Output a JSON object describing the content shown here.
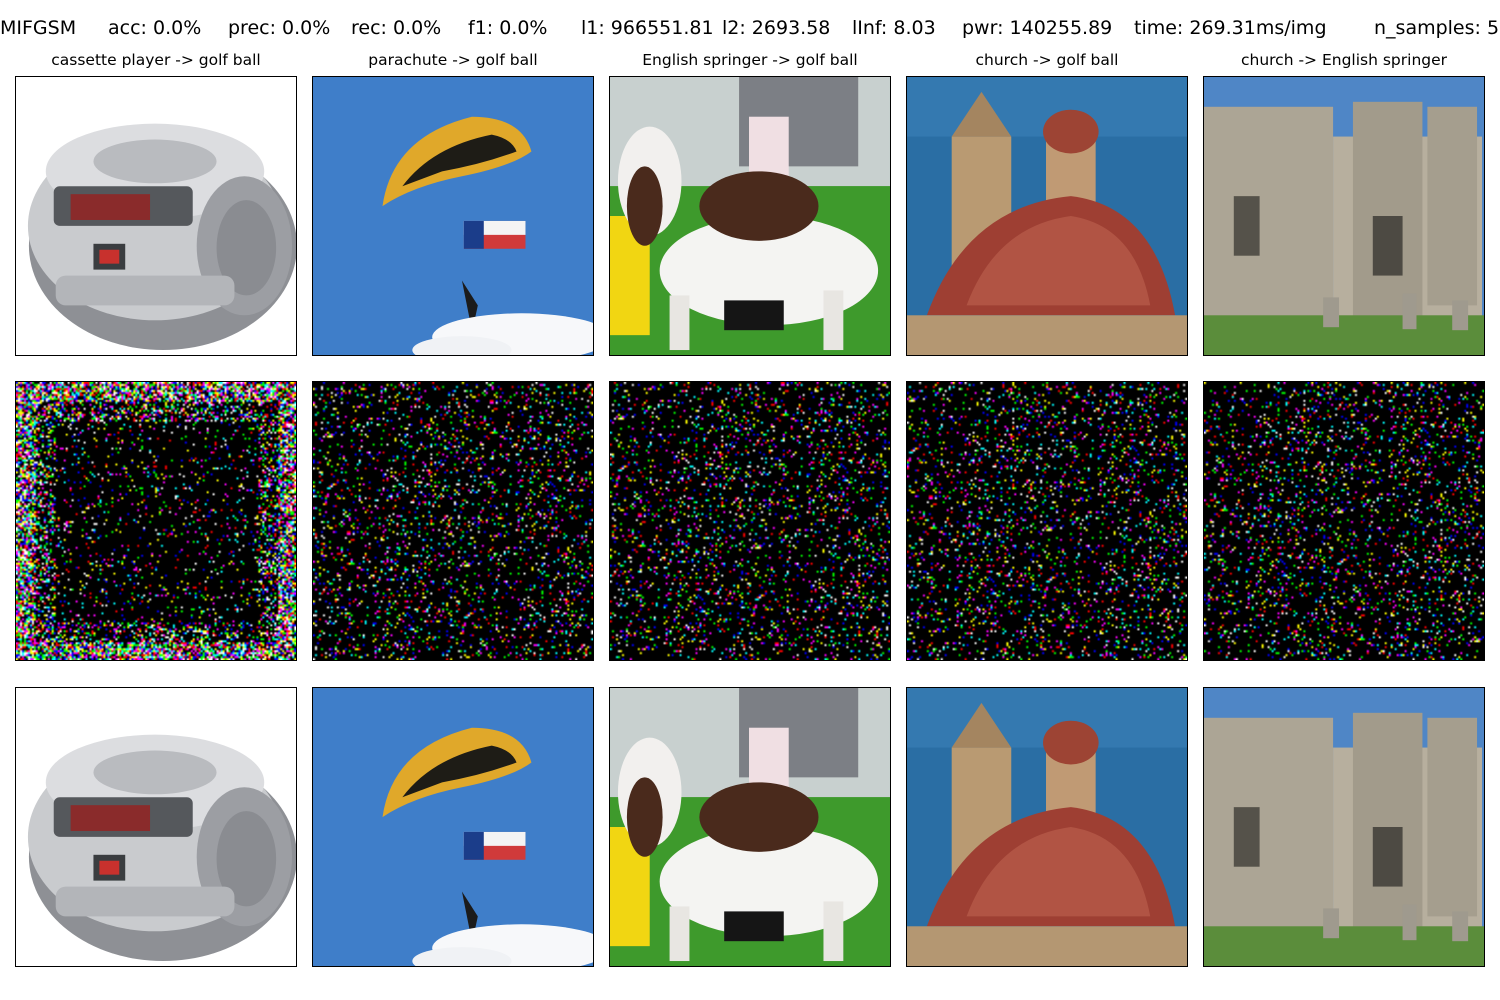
{
  "header": {
    "method": "MIFGSM",
    "acc": "acc: 0.0%",
    "prec": "prec: 0.0%",
    "rec": "rec: 0.0%",
    "f1": "f1: 0.0%",
    "l1": "l1: 966551.81",
    "l2": "l2: 2693.58",
    "linf": "lInf: 8.03",
    "pwr": "pwr: 140255.89",
    "time": "time: 269.31ms/img",
    "n_samples": "n_samples: 5"
  },
  "columns": [
    {
      "title": "cassette player -> golf ball",
      "subject": "cassette-player"
    },
    {
      "title": "parachute -> golf ball",
      "subject": "parachute"
    },
    {
      "title": "English springer -> golf ball",
      "subject": "springer-dog"
    },
    {
      "title": "church -> golf ball",
      "subject": "church-dome"
    },
    {
      "title": "church -> English springer",
      "subject": "church-building"
    }
  ],
  "rows": [
    "original",
    "perturbation",
    "adversarial"
  ]
}
